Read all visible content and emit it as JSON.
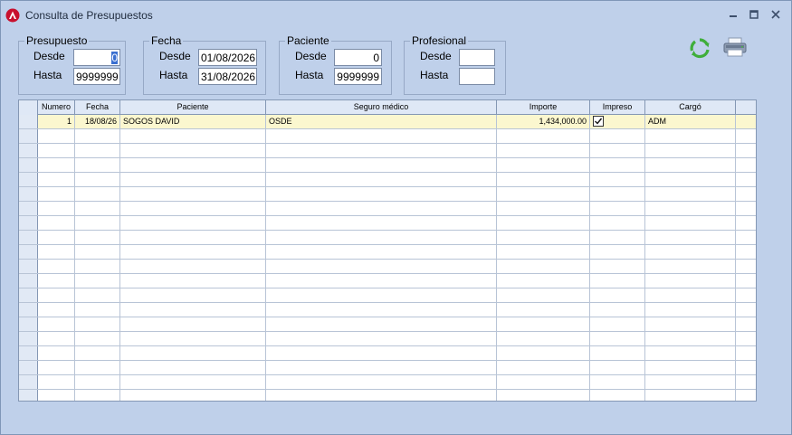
{
  "window": {
    "title": "Consulta de Presupuestos",
    "controls": [
      "minimize",
      "restore",
      "close"
    ]
  },
  "filters": {
    "presupuesto": {
      "title": "Presupuesto",
      "desde_label": "Desde",
      "hasta_label": "Hasta",
      "desde": "0",
      "hasta": "9999999"
    },
    "fecha": {
      "title": "Fecha",
      "desde_label": "Desde",
      "hasta_label": "Hasta",
      "desde": "01/08/2026",
      "hasta": "31/08/2026"
    },
    "paciente": {
      "title": "Paciente",
      "desde_label": "Desde",
      "hasta_label": "Hasta",
      "desde": "0",
      "hasta": "9999999"
    },
    "profesional": {
      "title": "Profesional",
      "desde_label": "Desde",
      "hasta_label": "Hasta",
      "desde": "",
      "hasta": ""
    }
  },
  "toolbar": {
    "refresh_icon": "refresh-icon",
    "print_icon": "printer-icon"
  },
  "grid": {
    "columns": [
      "Numero",
      "Fecha",
      "Paciente",
      "Seguro médico",
      "Importe",
      "Impreso",
      "Cargó"
    ],
    "rows": [
      {
        "numero": "1",
        "fecha": "18/08/26",
        "paciente": "SOGOS DAVID",
        "seguro": "OSDE",
        "importe": "1,434,000.00",
        "impreso": true,
        "cargo": "ADM"
      }
    ],
    "empty_rows": 19
  }
}
